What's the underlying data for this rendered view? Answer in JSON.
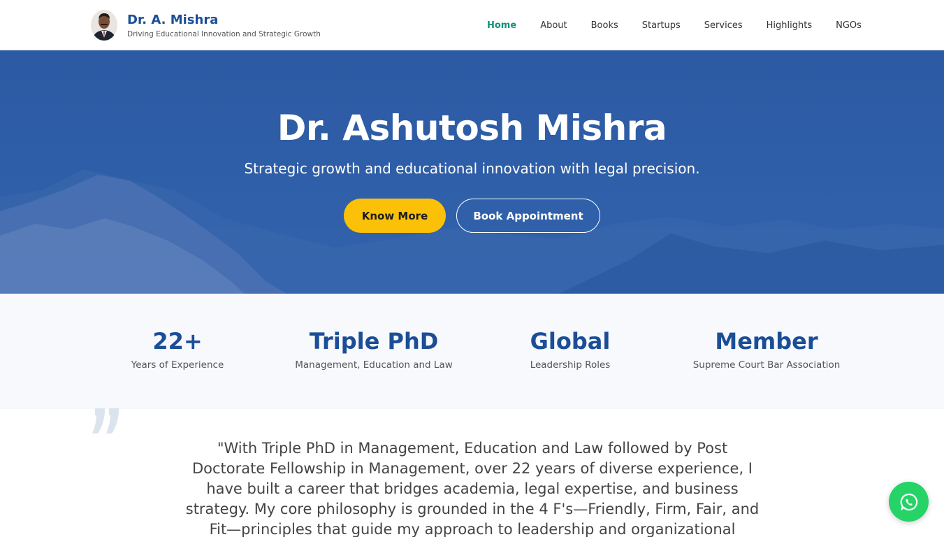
{
  "header": {
    "brand_name": "Dr. A. Mishra",
    "brand_tagline": "Driving Educational Innovation and Strategic Growth",
    "nav": [
      {
        "label": "Home",
        "active": true
      },
      {
        "label": "About",
        "active": false
      },
      {
        "label": "Books",
        "active": false
      },
      {
        "label": "Startups",
        "active": false
      },
      {
        "label": "Services",
        "active": false
      },
      {
        "label": "Highlights",
        "active": false
      },
      {
        "label": "NGOs",
        "active": false
      }
    ]
  },
  "hero": {
    "title": "Dr. Ashutosh Mishra",
    "subtitle": "Strategic growth and educational innovation with legal precision.",
    "primary_button": "Know More",
    "secondary_button": "Book Appointment"
  },
  "stats": [
    {
      "value": "22+",
      "label": "Years of Experience"
    },
    {
      "value": "Triple PhD",
      "label": "Management, Education and Law"
    },
    {
      "value": "Global",
      "label": "Leadership Roles"
    },
    {
      "value": "Member",
      "label": "Supreme Court Bar Association"
    }
  ],
  "quote": {
    "text": "\"With Triple PhD in Management, Education and Law followed by Post Doctorate Fellowship in Management, over 22 years of diverse experience, I have built a career that bridges academia, legal expertise, and business strategy. My core philosophy is grounded in the 4 F's—Friendly, Firm, Fair, and Fit—principles that guide my approach to leadership and organizational growth.\""
  },
  "icons": {
    "avatar": "avatar-portrait",
    "quote": "quote-icon",
    "whatsapp": "whatsapp-icon"
  },
  "colors": {
    "brand": "#1b4e96",
    "nav_active": "#12927d",
    "hero_bg": "#2f5ea8",
    "accent_button": "#fbc108",
    "whatsapp": "#25d366"
  }
}
